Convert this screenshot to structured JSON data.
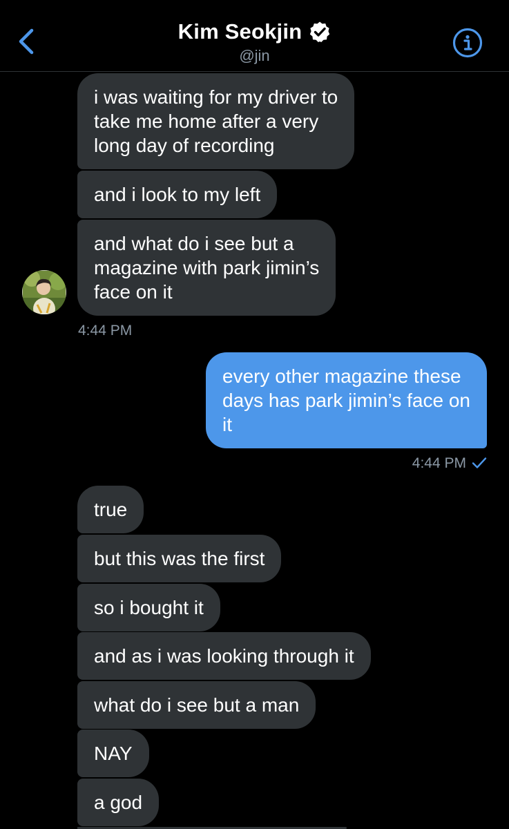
{
  "header": {
    "title": "Kim Seokjin",
    "handle": "@jin",
    "back_icon": "chevron-left-icon",
    "info_icon": "info-icon",
    "verified_icon": "verified-badge-icon",
    "accent_color": "#4d97ea"
  },
  "messages": [
    {
      "from": "them",
      "lines": [
        "i was waiting for my driver to",
        "take me home after a very",
        "long day of recording"
      ]
    },
    {
      "from": "them",
      "lines": [
        "and i look to my left"
      ]
    },
    {
      "from": "them",
      "lines": [
        "and what do i see but a",
        "magazine with park jimin’s",
        "face on it"
      ]
    },
    {
      "from": "me",
      "lines": [
        "every other magazine these",
        "days has park jimin’s face on",
        "it"
      ]
    },
    {
      "from": "them",
      "lines": [
        "true"
      ]
    },
    {
      "from": "them",
      "lines": [
        "but this was the first"
      ]
    },
    {
      "from": "them",
      "lines": [
        "so i bought it"
      ]
    },
    {
      "from": "them",
      "lines": [
        "and as i was looking through it"
      ]
    },
    {
      "from": "them",
      "lines": [
        "what do i see but a man"
      ]
    },
    {
      "from": "them",
      "lines": [
        "NAY"
      ]
    },
    {
      "from": "them",
      "lines": [
        "a god"
      ]
    }
  ],
  "timestamps": {
    "received": "4:44 PM",
    "sent": "4:44 PM"
  },
  "colors": {
    "incoming_bubble": "#2f3336",
    "outgoing_bubble": "#4d97ea",
    "secondary_text": "#8b98a5"
  }
}
